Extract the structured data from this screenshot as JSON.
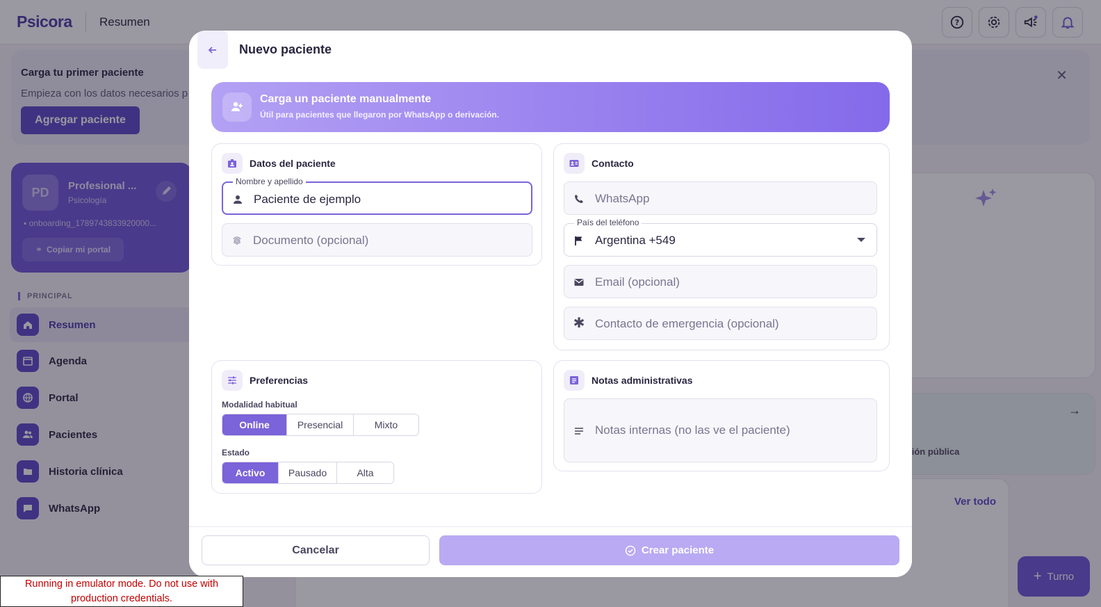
{
  "app": {
    "logo": "Psicora",
    "page_title": "Resumen"
  },
  "topbar_icons": [
    "help-icon",
    "gear-icon",
    "megaphone-icon",
    "bell-icon"
  ],
  "banner": {
    "title": "Carga tu primer paciente",
    "subtitle": "Empieza con los datos necesarios p",
    "button": "Agregar paciente"
  },
  "profile": {
    "initials": "PD",
    "name": "Profesional ...",
    "role": "Psicología",
    "handle": "onboarding_1789743833920000...",
    "copy_button": "Copiar mi portal"
  },
  "nav": {
    "section": "PRINCIPAL",
    "items": [
      {
        "label": "Resumen",
        "icon": "home-icon"
      },
      {
        "label": "Agenda",
        "icon": "calendar-icon"
      },
      {
        "label": "Portal",
        "icon": "globe-icon"
      },
      {
        "label": "Pacientes",
        "icon": "people-icon"
      },
      {
        "label": "Historia clínica",
        "icon": "folder-icon"
      },
      {
        "label": "WhatsApp",
        "icon": "chat-icon"
      }
    ]
  },
  "background": {
    "see_all": "Ver todo",
    "public_presentation": "ntación pública",
    "fab_label": "Turno"
  },
  "modal": {
    "title": "Nuevo paciente",
    "hero": {
      "title": "Carga un paciente manualmente",
      "subtitle": "Útil para pacientes que llegaron por WhatsApp o derivación."
    },
    "patient_panel": {
      "title": "Datos del paciente",
      "name_label": "Nombre y apellido",
      "name_value": "Paciente de ejemplo",
      "document_placeholder": "Documento (opcional)"
    },
    "contact_panel": {
      "title": "Contacto",
      "whatsapp_placeholder": "WhatsApp",
      "country_label": "País del teléfono",
      "country_value": "Argentina +549",
      "email_placeholder": "Email (opcional)",
      "emergency_placeholder": "Contacto de emergencia (opcional)"
    },
    "preferences_panel": {
      "title": "Preferencias",
      "modality_label": "Modalidad habitual",
      "modality_options": [
        "Online",
        "Presencial",
        "Mixto"
      ],
      "modality_selected": "Online",
      "status_label": "Estado",
      "status_options": [
        "Activo",
        "Pausado",
        "Alta"
      ],
      "status_selected": "Activo"
    },
    "notes_panel": {
      "title": "Notas administrativas",
      "notes_placeholder": "Notas internas (no las ve el paciente)"
    },
    "footer": {
      "cancel": "Cancelar",
      "create": "Crear paciente"
    }
  },
  "emulator_notice": "Running in emulator mode. Do not use with production credentials.",
  "colors": {
    "accent": "#7b63d9",
    "brand": "#4a3aa8",
    "create_disabled": "#b9aaf3"
  }
}
